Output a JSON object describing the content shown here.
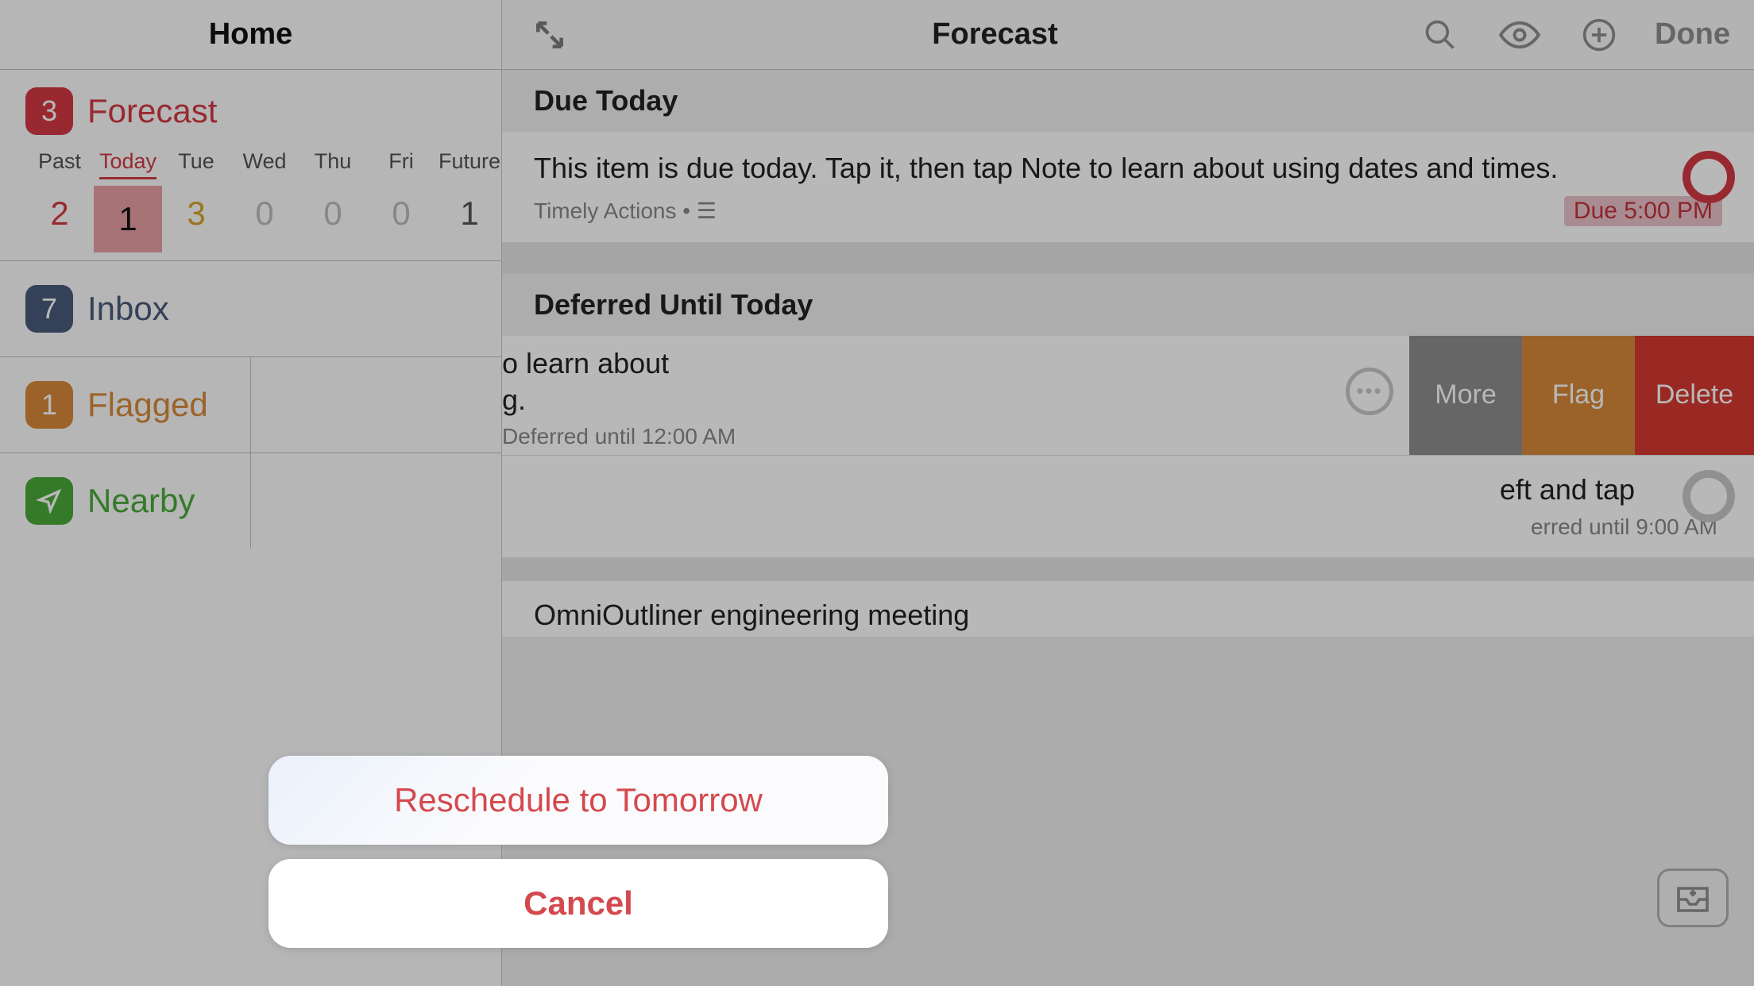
{
  "sidebar": {
    "title": "Home",
    "forecast": {
      "badge": "3",
      "label": "Forecast",
      "days": [
        {
          "label": "Past",
          "count": "2",
          "cls": "day-past"
        },
        {
          "label": "Today",
          "count": "1",
          "cls": "day-today"
        },
        {
          "label": "Tue",
          "count": "3",
          "cls": "day-tue"
        },
        {
          "label": "Wed",
          "count": "0",
          "cls": "day-zero"
        },
        {
          "label": "Thu",
          "count": "0",
          "cls": "day-zero"
        },
        {
          "label": "Fri",
          "count": "0",
          "cls": "day-zero"
        },
        {
          "label": "Future",
          "count": "1",
          "cls": "day-future"
        }
      ]
    },
    "inbox": {
      "badge": "7",
      "label": "Inbox"
    },
    "flagged": {
      "badge": "1",
      "label": "Flagged"
    },
    "nearby": {
      "label": "Nearby"
    }
  },
  "detail": {
    "title": "Forecast",
    "done": "Done",
    "sections": {
      "due_today": "Due Today",
      "deferred": "Deferred Until Today"
    },
    "task_due": {
      "title": "This item is due today. Tap it, then tap Note to learn about using dates and times.",
      "project": "Timely Actions • ☰",
      "due": "Due 5:00 PM"
    },
    "swiped": {
      "line1": "o learn about",
      "line2": "g.",
      "meta": "Deferred until 12:00 AM",
      "more": "More",
      "flag": "Flag",
      "delete": "Delete"
    },
    "partial": {
      "line1": "eft and tap",
      "meta": "erred until 9:00 AM"
    },
    "bottom": "OmniOutliner engineering meeting"
  },
  "sheet": {
    "reschedule": "Reschedule to Tomorrow",
    "cancel": "Cancel"
  }
}
